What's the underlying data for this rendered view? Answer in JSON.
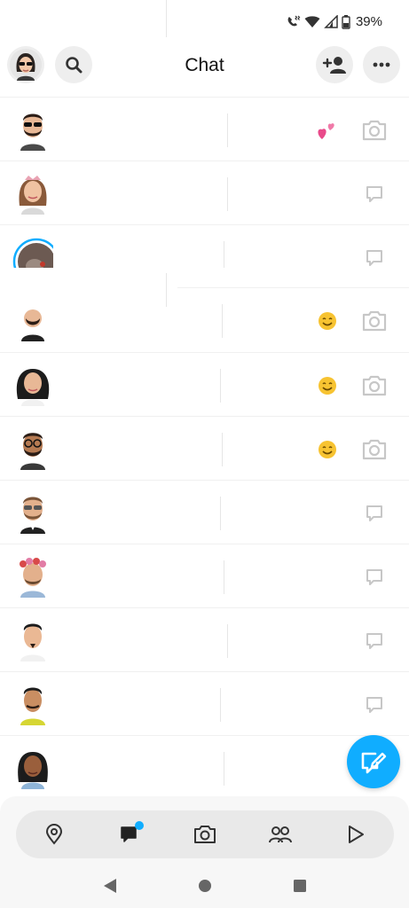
{
  "status_bar": {
    "battery_percent": "39%",
    "icons": [
      "vibrate-call-icon",
      "wifi-icon",
      "signal-icon",
      "battery-icon"
    ]
  },
  "header": {
    "title": "Chat",
    "left_buttons": [
      "profile-avatar",
      "search-icon"
    ],
    "right_buttons": [
      "add-friend-icon",
      "more-icon"
    ]
  },
  "chats": [
    {
      "avatar": "bitmoji-sunglasses-beard",
      "status_emoji": "two-hearts",
      "action_icon": "camera-icon"
    },
    {
      "avatar": "bitmoji-woman-crown",
      "status_emoji": "",
      "action_icon": "chat-bubble-icon"
    },
    {
      "avatar": "photo-story-ring",
      "status_emoji": "",
      "action_icon": "chat-bubble-icon"
    },
    {
      "avatar": "bitmoji-man-white-hat",
      "status_emoji": "smiling-face",
      "action_icon": "camera-icon"
    },
    {
      "avatar": "bitmoji-woman-dark-hair",
      "status_emoji": "smiling-face",
      "action_icon": "camera-icon"
    },
    {
      "avatar": "bitmoji-man-glasses-beard",
      "status_emoji": "smiling-face",
      "action_icon": "camera-icon"
    },
    {
      "avatar": "bitmoji-man-sunglasses-blazer",
      "status_emoji": "",
      "action_icon": "chat-bubble-icon"
    },
    {
      "avatar": "bitmoji-man-flower-crown",
      "status_emoji": "",
      "action_icon": "chat-bubble-icon"
    },
    {
      "avatar": "bitmoji-man-goatee",
      "status_emoji": "",
      "action_icon": "chat-bubble-icon"
    },
    {
      "avatar": "bitmoji-man-yellow-shirt",
      "status_emoji": "",
      "action_icon": "chat-bubble-icon"
    },
    {
      "avatar": "bitmoji-woman-dark-skin",
      "status_emoji": "",
      "action_icon": "chat-bubble-icon"
    }
  ],
  "fab": {
    "icon": "new-chat-icon",
    "color": "#10adff"
  },
  "bottom_nav": {
    "items": [
      "map-pin-icon",
      "chat-icon",
      "camera-icon",
      "friends-icon",
      "play-icon"
    ],
    "active": "chat-icon",
    "accent": "#10adff"
  },
  "system_nav": [
    "back-icon",
    "home-icon",
    "recents-icon"
  ]
}
